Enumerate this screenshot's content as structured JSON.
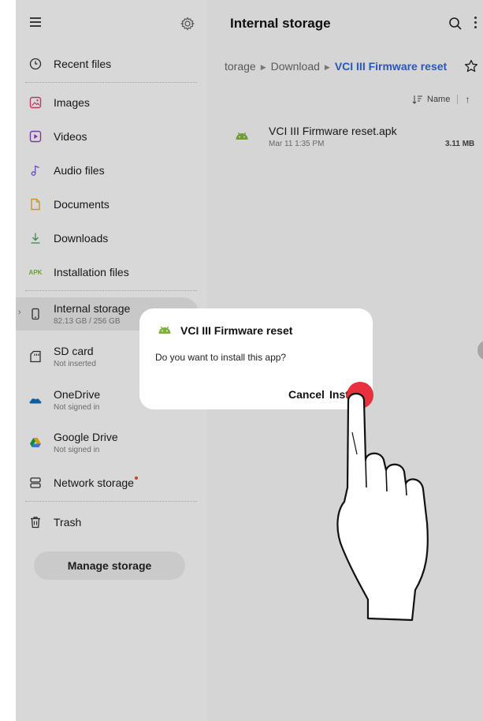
{
  "sidebar": {
    "menu_icon": "hamburger-icon",
    "settings_icon": "gear-icon",
    "items": [
      {
        "label": "Recent files",
        "icon": "clock-icon"
      },
      {
        "label": "Images",
        "icon": "image-icon",
        "color": "#d6416b"
      },
      {
        "label": "Videos",
        "icon": "video-icon",
        "color": "#8d3ec4"
      },
      {
        "label": "Audio files",
        "icon": "music-note-icon",
        "color": "#7a55d8"
      },
      {
        "label": "Documents",
        "icon": "document-icon",
        "color": "#f0a33c"
      },
      {
        "label": "Downloads",
        "icon": "download-icon",
        "color": "#3aa356"
      },
      {
        "label": "Installation files",
        "icon": "apk-icon",
        "badge": "APK",
        "color": "#7db33c"
      }
    ],
    "storage": [
      {
        "label": "Internal storage",
        "sub": "82.13 GB / 256 GB",
        "icon": "phone-icon"
      },
      {
        "label": "SD card",
        "sub": "Not inserted",
        "icon": "sd-card-icon"
      },
      {
        "label": "OneDrive",
        "sub": "Not signed in",
        "icon": "onedrive-icon"
      },
      {
        "label": "Google Drive",
        "sub": "Not signed in",
        "icon": "google-drive-icon"
      },
      {
        "label": "Network storage",
        "icon": "network-storage-icon"
      }
    ],
    "trash": {
      "label": "Trash",
      "icon": "trash-icon"
    },
    "manage_button": "Manage storage"
  },
  "main": {
    "title": "Internal storage",
    "breadcrumb": {
      "part1": "torage",
      "part2": "Download",
      "current": "VCI III Firmware reset"
    },
    "sort": {
      "label": "Name"
    },
    "files": [
      {
        "name": "VCI III Firmware reset.apk",
        "date": "Mar 11 1:35 PM",
        "size": "3.11 MB",
        "icon": "android-icon"
      }
    ]
  },
  "dialog": {
    "title": "VCI III Firmware reset",
    "message": "Do you want to install this app?",
    "cancel": "Cancel",
    "install": "Inst"
  },
  "colors": {
    "accent": "#2f63d4",
    "tap": "#e8303f",
    "android": "#7db33c"
  }
}
